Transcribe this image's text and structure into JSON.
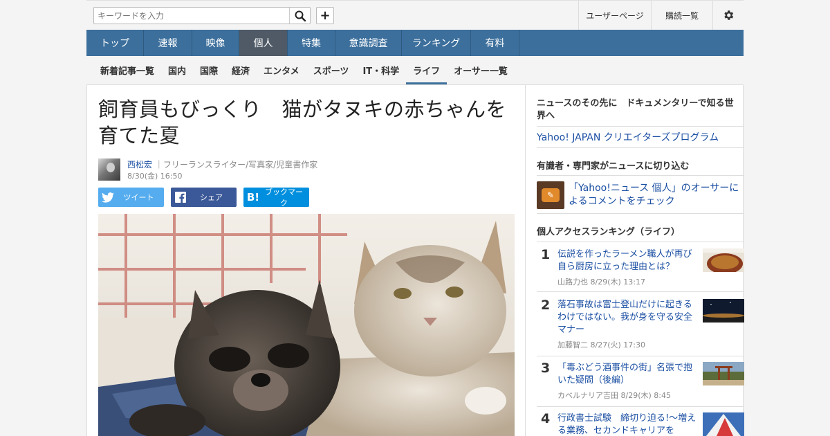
{
  "search": {
    "placeholder": "キーワードを入力"
  },
  "header": {
    "user_page": "ユーザーページ",
    "subscriptions": "購読一覧"
  },
  "main_nav": [
    {
      "label": "トップ",
      "active": false
    },
    {
      "label": "速報",
      "active": false
    },
    {
      "label": "映像",
      "active": false
    },
    {
      "label": "個人",
      "active": true
    },
    {
      "label": "特集",
      "active": false
    },
    {
      "label": "意識調査",
      "active": false
    },
    {
      "label": "ランキング",
      "active": false
    },
    {
      "label": "有料",
      "active": false
    }
  ],
  "sub_nav": [
    {
      "label": "新着記事一覧",
      "active": false
    },
    {
      "label": "国内",
      "active": false
    },
    {
      "label": "国際",
      "active": false
    },
    {
      "label": "経済",
      "active": false
    },
    {
      "label": "エンタメ",
      "active": false
    },
    {
      "label": "スポーツ",
      "active": false
    },
    {
      "label": "IT・科学",
      "active": false
    },
    {
      "label": "ライフ",
      "active": true
    },
    {
      "label": "オーサー一覧",
      "active": false
    }
  ],
  "article": {
    "headline": "飼育員もびっくり　猫がタヌキの赤ちゃんを育てた夏",
    "author_name": "西松宏",
    "author_title": "｜フリーランスライター/写真家/児童書作家",
    "date": "8/30(金) 16:50"
  },
  "share": {
    "tweet": "ツイート",
    "facebook": "シェア",
    "hatena": "ブックマーク"
  },
  "sidebar": {
    "promo_title": "ニュースのその先に　ドキュメンタリーで知る世界へ",
    "promo_link": "Yahoo! JAPAN クリエイターズプログラム",
    "expert_title": "有識者・専門家がニュースに切り込む",
    "expert_link": "「Yahoo!ニュース 個人」のオーサーによるコメントをチェック",
    "ranking_title": "個人アクセスランキング（ライフ）",
    "ranking": [
      {
        "rank": "1",
        "title": "伝説を作ったラーメン職人が再び自ら厨房に立った理由とは？",
        "author": "山路力也",
        "date": "8/29(木) 13:17"
      },
      {
        "rank": "2",
        "title": "落石事故は富士登山だけに起きるわけではない。我が身を守る安全マナー",
        "author": "加藤智二",
        "date": "8/27(火) 17:30"
      },
      {
        "rank": "3",
        "title": "「毒ぶどう酒事件の街」名張で抱いた疑問（後編）",
        "author": "カベルナリア吉田",
        "date": "8/29(木) 8:45"
      },
      {
        "rank": "4",
        "title": "行政書士試験　締切り迫る!～増える業務、セカンドキャリアを",
        "author": "",
        "date": ""
      }
    ]
  },
  "colors": {
    "nav": "#3c6f9c",
    "nav_active": "#4f5a66",
    "link": "#1a4ea2",
    "twitter": "#55acee",
    "facebook": "#3b5998",
    "hatena": "#008fde"
  },
  "icons": [
    "search-icon",
    "plus-icon",
    "gear-icon",
    "twitter-icon",
    "facebook-icon",
    "hatena-icon",
    "comment-icon"
  ]
}
